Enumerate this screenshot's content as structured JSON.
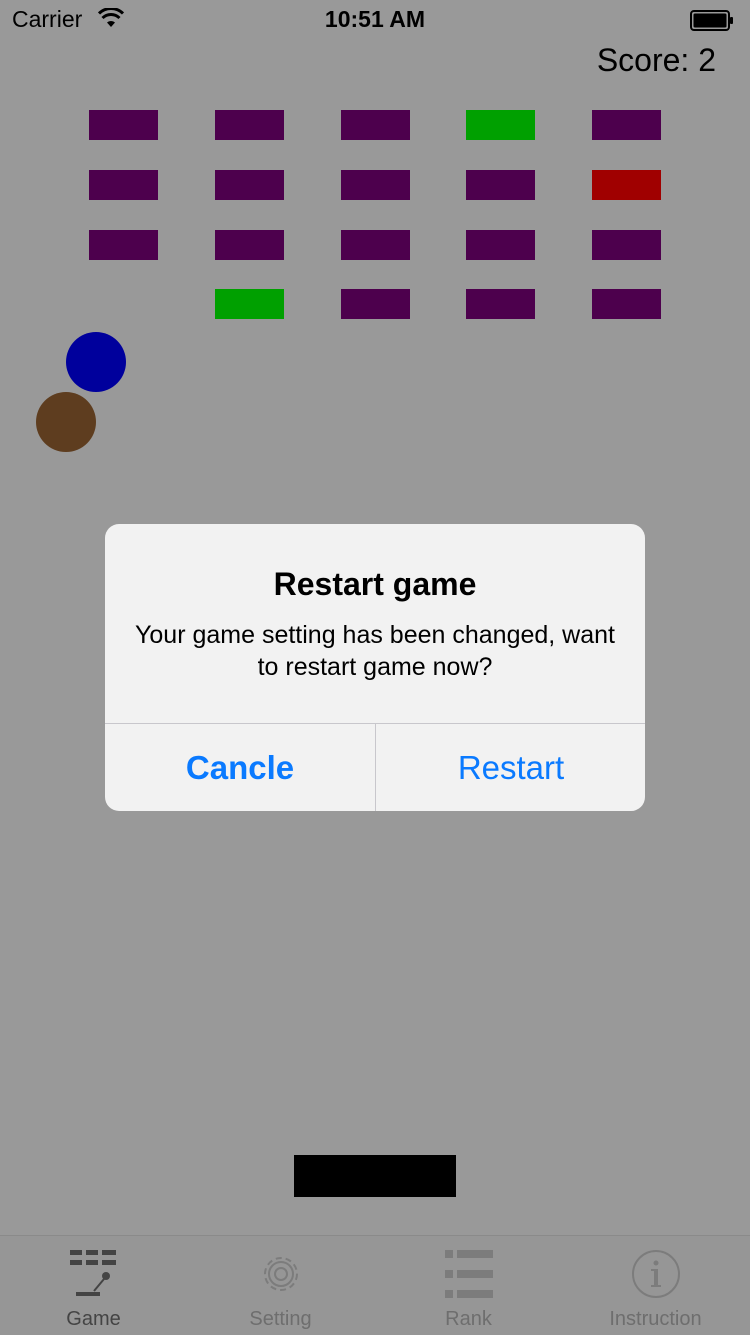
{
  "status_bar": {
    "carrier": "Carrier",
    "time": "10:51 AM"
  },
  "score_text": "Score: 2",
  "colors": {
    "brick_purple": "#4d004d",
    "brick_green": "#00a000",
    "brick_red": "#a00000",
    "ball_blue": "#00009c",
    "ball_brown": "#5e3d1f",
    "accent": "#0a7aff"
  },
  "alert": {
    "title": "Restart game",
    "message": "Your game setting has been changed, want to restart game now?",
    "cancel_label": "Cancle",
    "restart_label": "Restart"
  },
  "tabs": [
    {
      "label": "Game",
      "icon": "game-icon"
    },
    {
      "label": "Setting",
      "icon": "gear-icon"
    },
    {
      "label": "Rank",
      "icon": "list-icon"
    },
    {
      "label": "Instruction",
      "icon": "info-icon"
    }
  ]
}
